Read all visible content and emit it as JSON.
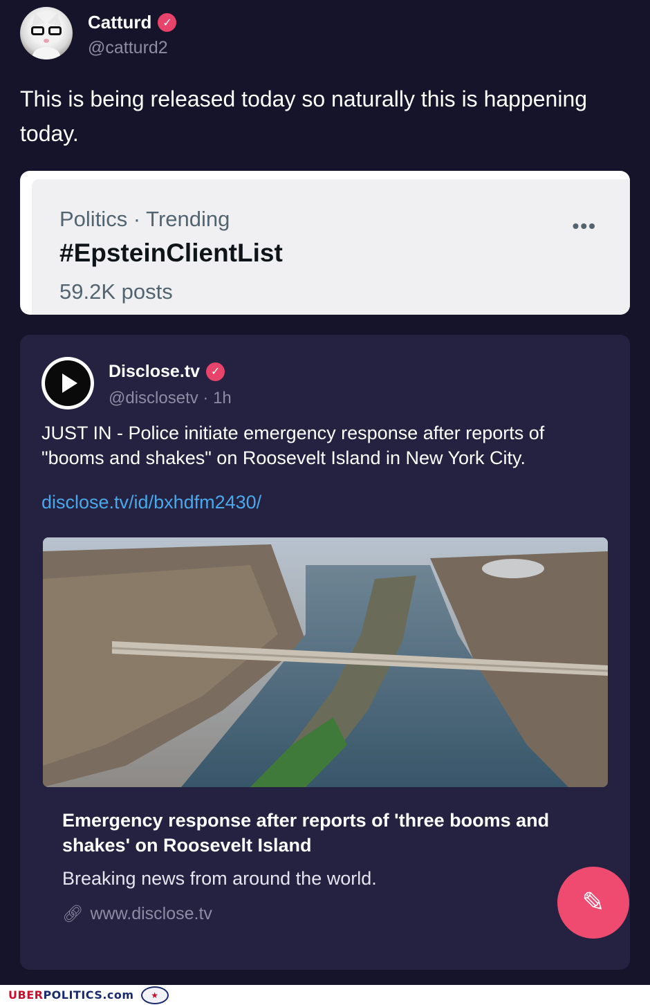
{
  "post": {
    "author_name": "Catturd",
    "author_handle": "@catturd2",
    "text": "This is being released today so naturally this is happening today."
  },
  "trend": {
    "meta": "Politics · Trending",
    "tag": "#EpsteinClientList",
    "count": "59.2K posts",
    "more": "•••"
  },
  "quote": {
    "author_name": "Disclose.tv",
    "author_handle": "@disclosetv · 1h",
    "text": "JUST IN - Police initiate emergency response after reports of \"booms and shakes\" on Roosevelt Island in New York City.",
    "link": "disclose.tv/id/bxhdfm2430/",
    "card_title": "Emergency response after reports of 'three booms and shakes' on Roosevelt Island",
    "card_description": "Breaking news from around the world.",
    "card_domain": "www.disclose.tv"
  },
  "icons": {
    "verified": "verified-check-icon",
    "more": "more-dots-icon",
    "link": "link-chain-icon",
    "compose": "compose-sparkle-pen-icon"
  },
  "footer": {
    "watermark_uber": "UBER",
    "watermark_rest": "POLITICS.com"
  },
  "colors": {
    "background": "#16142a",
    "quote_card": "#242240",
    "verified": "#e8436b",
    "link": "#4aa8ea",
    "fab": "#ef4a6f"
  }
}
